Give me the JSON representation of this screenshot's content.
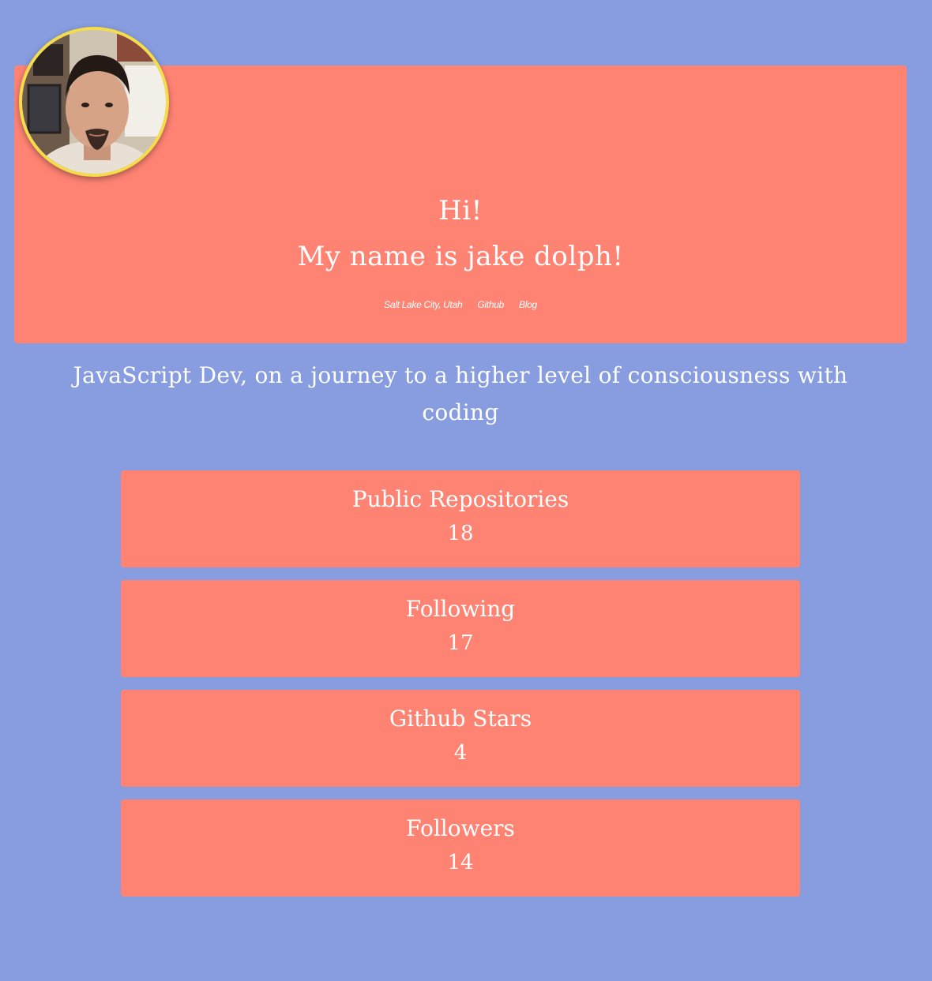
{
  "profile": {
    "greeting_line1": "Hi!",
    "greeting_line2": "My name is jake dolph!",
    "location": "Salt Lake City, Utah",
    "github_link": "Github",
    "blog_link": "Blog",
    "bio": "JavaScript Dev, on a journey to a higher level of consciousness with coding"
  },
  "stats": [
    {
      "label": "Public Repositories",
      "value": "18"
    },
    {
      "label": "Following",
      "value": "17"
    },
    {
      "label": "Github Stars",
      "value": "4"
    },
    {
      "label": "Followers",
      "value": "14"
    }
  ],
  "colors": {
    "background": "#889ddf",
    "card": "#ff8373",
    "avatar_border": "#f4dc4a",
    "text": "#ffffff"
  }
}
